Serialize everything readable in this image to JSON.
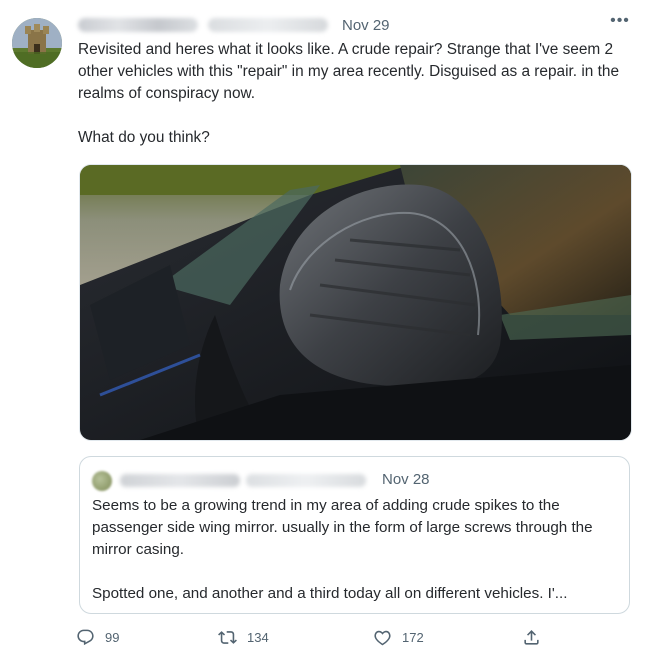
{
  "tweet": {
    "date": "Nov 29",
    "more_label": "•••",
    "paragraphs": [
      "Revisited and heres what it looks like. A crude repair? Strange that I've seem 2 other vehicles with this \"repair\" in my area recently. Disguised as a repair. in the realms of conspiracy now.",
      "What do you think?"
    ]
  },
  "quote": {
    "date": "Nov 28",
    "paragraphs": [
      "Seems to be a growing trend in my area of adding crude spikes to the passenger side wing mirror. usually in the form of large screws through the mirror casing.",
      "Spotted one, and another and a third today all on different vehicles. I'..."
    ]
  },
  "actions": {
    "replies": "99",
    "retweets": "134",
    "likes": "172"
  },
  "icons": {
    "reply": "reply-icon",
    "retweet": "retweet-icon",
    "like": "like-icon",
    "share": "share-icon",
    "more": "more-icon"
  },
  "colors": {
    "text": "#0f1419",
    "muted": "#536471",
    "border": "#cfd9de"
  }
}
